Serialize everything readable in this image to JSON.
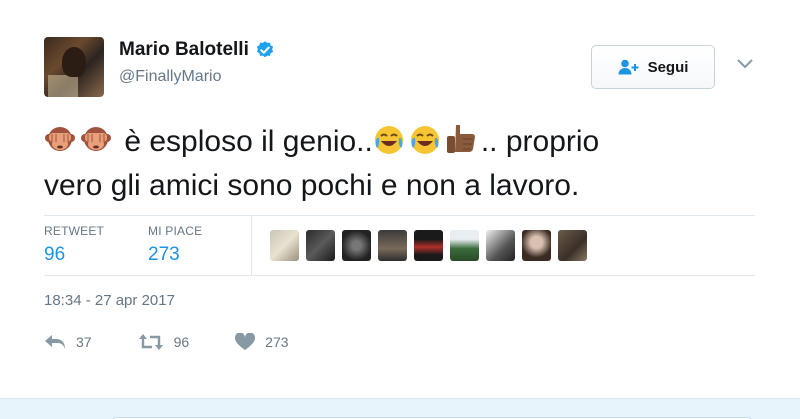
{
  "author": {
    "name": "Mario Balotelli",
    "handle": "@FinallyMario"
  },
  "follow_button": {
    "label": "Segui"
  },
  "tweet": {
    "text_1": "è esploso il genio..",
    "text_2": ".. proprio",
    "text_3": "vero gli amici sono pochi e non a lavoro."
  },
  "stats": {
    "retweet_label": "RETWEET",
    "retweet_count": "96",
    "likes_label": "MI PIACE",
    "likes_count": "273"
  },
  "timestamp": "18:34 - 27 apr 2017",
  "actions": {
    "reply_count": "37",
    "retweet_count": "96",
    "like_count": "273"
  },
  "colors": {
    "link_blue": "#1b95e0",
    "muted": "#657786",
    "verified": "#1da1f2"
  },
  "icons": [
    "verified-icon",
    "follow-person-icon",
    "chevron-down-icon",
    "see-no-evil-monkey-icon",
    "joy-icon",
    "thumbs-up-icon",
    "reply-icon",
    "retweet-icon",
    "heart-icon"
  ]
}
